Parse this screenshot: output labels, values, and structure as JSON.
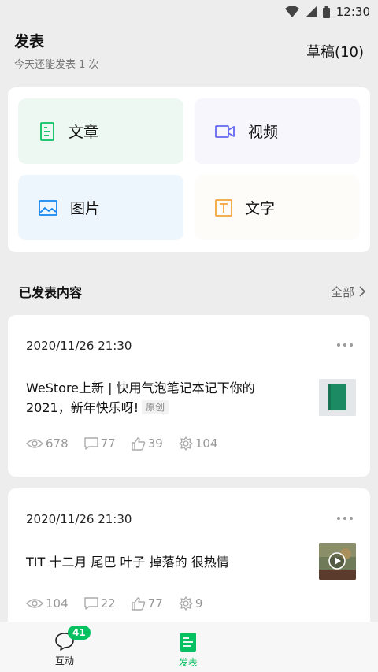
{
  "status_bar": {
    "time": "12:30"
  },
  "header": {
    "title": "发表",
    "subtitle": "今天还能发表 1 次",
    "drafts_label": "草稿(10)"
  },
  "compose": {
    "article": "文章",
    "video": "视频",
    "image": "图片",
    "text": "文字"
  },
  "published": {
    "title": "已发表内容",
    "all_label": "全部"
  },
  "posts": [
    {
      "date": "2020/11/26 21:30",
      "title": "WeStore上新 | 快用气泡笔记本记下你的2021，新年快乐呀!",
      "tag": "原创",
      "views": "678",
      "comments": "77",
      "likes": "39",
      "shares": "104"
    },
    {
      "date": "2020/11/26 21:30",
      "title": "TIT 十二月 尾巴 叶子 掉落的 很热情",
      "views": "104",
      "comments": "22",
      "likes": "77",
      "shares": "9"
    }
  ],
  "tabbar": {
    "interact_label": "互动",
    "interact_badge": "41",
    "publish_label": "发表"
  },
  "colors": {
    "accent": "#07c160",
    "article_icon": "#07c160",
    "video_icon": "#6467f0",
    "image_icon": "#1485ee",
    "text_icon": "#f4a43a"
  }
}
